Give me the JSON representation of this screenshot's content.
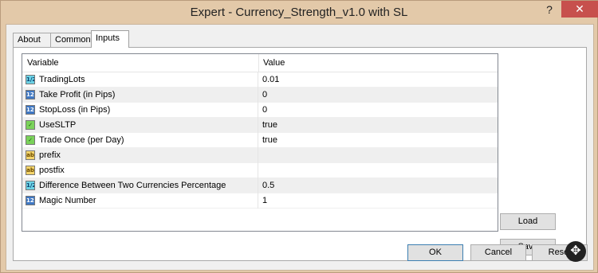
{
  "window": {
    "title": "Expert - Currency_Strength_v1.0 with SL",
    "help_label": "?",
    "close_label": "✕"
  },
  "tabs": [
    {
      "label": "About",
      "active": false
    },
    {
      "label": "Common",
      "active": false
    },
    {
      "label": "Inputs",
      "active": true
    }
  ],
  "grid": {
    "columns": [
      "Variable",
      "Value"
    ],
    "rows": [
      {
        "type": "double",
        "icon": "1/2",
        "name": "TradingLots",
        "value": "0.01"
      },
      {
        "type": "int",
        "icon": "123",
        "name": "Take Profit (in Pips)",
        "value": "0"
      },
      {
        "type": "int",
        "icon": "123",
        "name": "StopLoss (in Pips)",
        "value": "0"
      },
      {
        "type": "bool",
        "icon": "✓",
        "name": "UseSLTP",
        "value": "true"
      },
      {
        "type": "bool",
        "icon": "✓",
        "name": "Trade Once (per Day)",
        "value": "true"
      },
      {
        "type": "string",
        "icon": "ab",
        "name": "prefix",
        "value": ""
      },
      {
        "type": "string",
        "icon": "ab",
        "name": "postfix",
        "value": ""
      },
      {
        "type": "double",
        "icon": "1/2",
        "name": "Difference Between Two Currencies Percentage",
        "value": "0.5"
      },
      {
        "type": "int",
        "icon": "123",
        "name": "Magic Number",
        "value": "1"
      }
    ]
  },
  "side_buttons": {
    "load": "Load",
    "save": "Save"
  },
  "footer_buttons": {
    "ok": "OK",
    "cancel": "Cancel",
    "reset": "Reset"
  },
  "colors": {
    "titlebar": "#e3c9a9",
    "close": "#c7504d",
    "dialog": "#f0f0f0"
  }
}
